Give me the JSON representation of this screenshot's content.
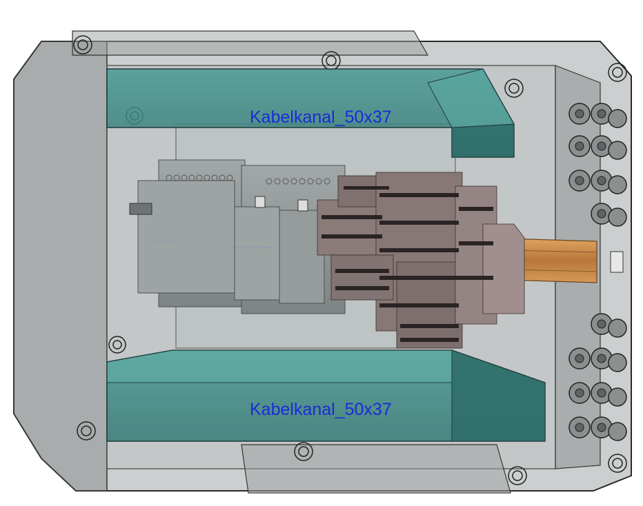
{
  "scene": {
    "cable_ducts": [
      {
        "label": "Kabelkanal_50x37"
      },
      {
        "label": "Kabelkanal_50x37"
      }
    ],
    "colors": {
      "background": "#ffffff",
      "enclosure": "#9aa0a0",
      "cable_duct": "#3f8f8a",
      "din_rail": "#c98d4a",
      "modules": "#8e9494",
      "terminal_blocks": "#8a7a78",
      "labels": "#1a2bd6"
    }
  }
}
